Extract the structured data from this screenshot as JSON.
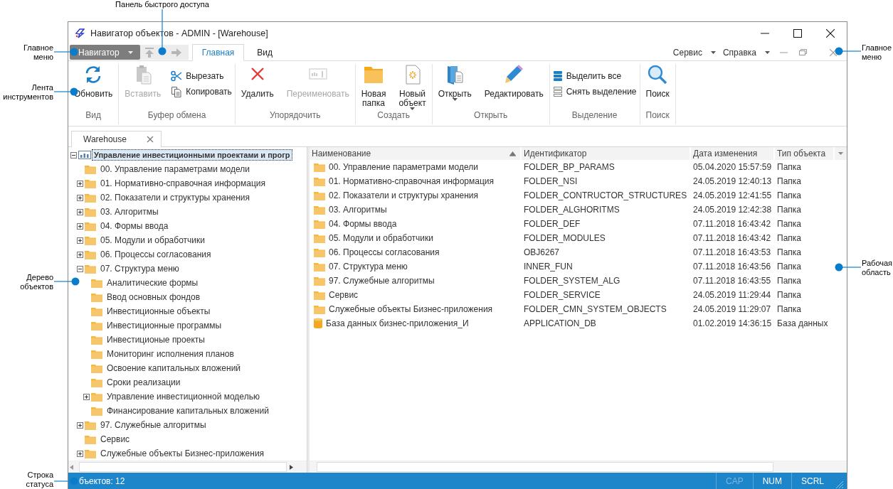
{
  "callouts": [
    {
      "text": "Панель быстрого доступа",
      "kind": "top"
    },
    {
      "text": "Главное меню",
      "kind": "left"
    },
    {
      "text": "Лента инструментов",
      "kind": "left"
    },
    {
      "text": "Дерево объектов",
      "kind": "left"
    },
    {
      "text": "Строка статуса",
      "kind": "left"
    },
    {
      "text": "Главное меню",
      "kind": "right"
    },
    {
      "text": "Рабочая область",
      "kind": "right"
    }
  ],
  "window": {
    "title": "Навигатор объектов - ADMIN - [Warehouse]"
  },
  "menu": {
    "app_button": "Навигатор",
    "tabs": [
      {
        "label": "Главная",
        "selected": true
      },
      {
        "label": "Вид",
        "selected": false
      }
    ],
    "menus": [
      "Сервис",
      "Справка"
    ]
  },
  "ribbon": {
    "groups": [
      {
        "title": "Вид",
        "items": [
          {
            "label": "Обновить",
            "kind": "large",
            "disabled": false,
            "dropdown": false
          }
        ]
      },
      {
        "title": "Буфер обмена",
        "items": [
          {
            "label": "Вставить",
            "kind": "large",
            "disabled": true,
            "dropdown": false
          },
          {
            "label": "Вырезать",
            "kind": "small",
            "disabled": false,
            "dropdown": false
          },
          {
            "label": "Копировать",
            "kind": "small",
            "disabled": false,
            "dropdown": false
          }
        ]
      },
      {
        "title": "Упорядочить",
        "items": [
          {
            "label": "Удалить",
            "kind": "large",
            "disabled": false,
            "dropdown": false
          },
          {
            "label": "Переименовать",
            "kind": "large",
            "disabled": true,
            "dropdown": false
          }
        ]
      },
      {
        "title": "Создать",
        "items": [
          {
            "label": "Новая папка",
            "kind": "large",
            "disabled": false,
            "dropdown": false
          },
          {
            "label": "Новый объект",
            "kind": "large",
            "disabled": false,
            "dropdown": true
          }
        ]
      },
      {
        "title": "Открыть",
        "items": [
          {
            "label": "Открыть",
            "kind": "large",
            "disabled": false,
            "dropdown": true
          },
          {
            "label": "Редактировать",
            "kind": "large",
            "disabled": false,
            "dropdown": false
          }
        ]
      },
      {
        "title": "Выделение",
        "items": [
          {
            "label": "Выделить все",
            "kind": "small",
            "disabled": false,
            "dropdown": false
          },
          {
            "label": "Снять выделение",
            "kind": "small",
            "disabled": false,
            "dropdown": false
          }
        ]
      },
      {
        "title": "Поиск",
        "items": [
          {
            "label": "Поиск",
            "kind": "large",
            "disabled": false,
            "dropdown": false
          }
        ]
      }
    ]
  },
  "document_tabs": [
    {
      "label": "Warehouse",
      "selected": true
    }
  ],
  "tree": {
    "nodes": [
      {
        "label": "Управление инвестиционными проектами и прогр",
        "kind": "repository",
        "expandable": true,
        "expanded": true,
        "selected": true,
        "children": [
          {
            "label": "00. Управление параметрами модели",
            "kind": "folder",
            "expandable": false,
            "selected": false
          },
          {
            "label": "01. Нормативно-справочная информация",
            "kind": "folder",
            "expandable": true,
            "expanded": false,
            "selected": false
          },
          {
            "label": "02. Показатели и структуры хранения",
            "kind": "folder",
            "expandable": true,
            "expanded": false,
            "selected": false
          },
          {
            "label": "03. Алгоритмы",
            "kind": "folder",
            "expandable": true,
            "expanded": false,
            "selected": false
          },
          {
            "label": "04. Формы ввода",
            "kind": "folder",
            "expandable": true,
            "expanded": false,
            "selected": false
          },
          {
            "label": "05. Модули и обработчики",
            "kind": "folder",
            "expandable": true,
            "expanded": false,
            "selected": false
          },
          {
            "label": "06. Процессы согласования",
            "kind": "folder",
            "expandable": true,
            "expanded": false,
            "selected": false
          },
          {
            "label": "07. Структура меню",
            "kind": "folder",
            "expandable": true,
            "expanded": true,
            "selected": false,
            "children": [
              {
                "label": "Аналитические формы",
                "kind": "folder",
                "expandable": false,
                "selected": false
              },
              {
                "label": "Ввод основных фондов",
                "kind": "folder",
                "expandable": false,
                "selected": false
              },
              {
                "label": "Инвестиционные объекты",
                "kind": "folder",
                "expandable": false,
                "selected": false
              },
              {
                "label": "Инвестиционные программы",
                "kind": "folder",
                "expandable": false,
                "selected": false
              },
              {
                "label": "Инвестиционые проекты",
                "kind": "folder",
                "expandable": false,
                "selected": false
              },
              {
                "label": "Мониторинг исполнения планов",
                "kind": "folder",
                "expandable": false,
                "selected": false
              },
              {
                "label": "Освоение капитальных вложений",
                "kind": "folder",
                "expandable": false,
                "selected": false
              },
              {
                "label": "Сроки реализации",
                "kind": "folder",
                "expandable": false,
                "selected": false
              },
              {
                "label": "Управление инвестиционной моделью",
                "kind": "folder",
                "expandable": true,
                "expanded": false,
                "selected": false
              },
              {
                "label": "Финансирование капитальных вложений",
                "kind": "folder",
                "expandable": false,
                "selected": false
              }
            ]
          },
          {
            "label": "97. Служебные алгоритмы",
            "kind": "folder",
            "expandable": true,
            "expanded": false,
            "selected": false
          },
          {
            "label": "Сервис",
            "kind": "folder",
            "expandable": false,
            "selected": false
          },
          {
            "label": "Служебные объекты Бизнес-приложения",
            "kind": "folder",
            "expandable": true,
            "expanded": false,
            "selected": false
          }
        ]
      }
    ]
  },
  "table": {
    "columns": [
      {
        "label": "Наименование",
        "sorted": true
      },
      {
        "label": "Идентификатор",
        "sorted": false
      },
      {
        "label": "Дата изменения",
        "sorted": false
      },
      {
        "label": "Тип объекта",
        "sorted": false
      }
    ],
    "rows": [
      {
        "kind": "folder",
        "cells": [
          "00. Управление параметрами модели",
          "FOLDER_BP_PARAMS",
          "05.04.2020 15:57:59",
          "Папка"
        ]
      },
      {
        "kind": "folder",
        "cells": [
          "01. Нормативно-справочная информация",
          "FOLDER_NSI",
          "24.05.2019 12:40:13",
          "Папка"
        ]
      },
      {
        "kind": "folder",
        "cells": [
          "02. Показатели и структуры хранения",
          "FOLDER_CONTRUCTOR_STRUCTURES",
          "24.05.2019 12:41:55",
          "Папка"
        ]
      },
      {
        "kind": "folder",
        "cells": [
          "03. Алгоритмы",
          "FOLDER_ALGHORITMS",
          "24.05.2019 12:42:38",
          "Папка"
        ]
      },
      {
        "kind": "folder",
        "cells": [
          "04. Формы ввода",
          "FOLDER_DEF",
          "07.11.2018 16:43:42",
          "Папка"
        ]
      },
      {
        "kind": "folder",
        "cells": [
          "05. Модули и обработчики",
          "FOLDER_MODULES",
          "07.11.2018 16:43:42",
          "Папка"
        ]
      },
      {
        "kind": "folder",
        "cells": [
          "06. Процессы согласования",
          "OBJ6267",
          "07.11.2018 16:43:53",
          "Папка"
        ]
      },
      {
        "kind": "folder",
        "cells": [
          "07. Структура меню",
          "INNER_FUN",
          "07.11.2018 16:43:56",
          "Папка"
        ]
      },
      {
        "kind": "folder",
        "cells": [
          "97. Служебные алгоритмы",
          "FOLDER_SYSTEM_ALG",
          "07.11.2018 16:43:55",
          "Папка"
        ]
      },
      {
        "kind": "folder",
        "cells": [
          "Сервис",
          "FOLDER_SERVICE",
          "24.05.2019 11:29:44",
          "Папка"
        ]
      },
      {
        "kind": "folder",
        "cells": [
          "Служебные объекты Бизнес-приложения",
          "FOLDER_CMN_SYSTEM_OBJECTS",
          "24.05.2019 11:29:07",
          "Папка"
        ]
      },
      {
        "kind": "database",
        "cells": [
          "База данных бизнес-приложения_И",
          "APPLICATION_DB",
          "01.02.2019 14:36:15",
          "База данных"
        ]
      }
    ]
  },
  "status_bar": {
    "text": "бъектов: 12",
    "indicators": [
      {
        "label": "CAP",
        "on": false
      },
      {
        "label": "NUM",
        "on": true
      },
      {
        "label": "SCRL",
        "on": true
      }
    ]
  }
}
